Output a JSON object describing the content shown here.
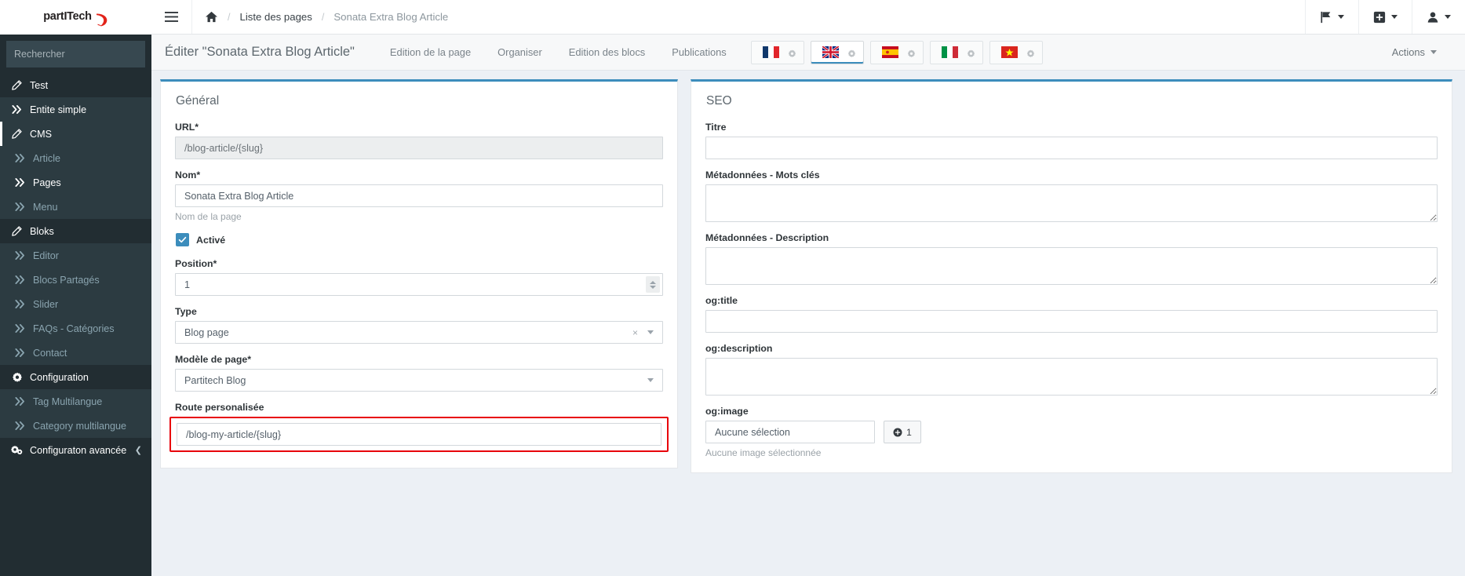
{
  "brand": {
    "logo_text": "partITech",
    "logo_icon": "swoosh-icon"
  },
  "sidebar": {
    "search": {
      "placeholder": "Rechercher",
      "value": "",
      "icon": "search-icon"
    },
    "items": [
      {
        "label": "Test",
        "icon": "pencil-icon",
        "level": 0,
        "state": "normal"
      },
      {
        "label": "Entite simple",
        "icon": "chevron-double-right-icon",
        "level": 0,
        "state": "hover"
      },
      {
        "label": "CMS",
        "icon": "pencil-icon",
        "level": 0,
        "state": "selected"
      },
      {
        "label": "Article",
        "icon": "chevron-double-right-icon",
        "level": 1,
        "state": "sub"
      },
      {
        "label": "Pages",
        "icon": "chevron-double-right-icon",
        "level": 1,
        "state": "sub-active"
      },
      {
        "label": "Menu",
        "icon": "chevron-double-right-icon",
        "level": 1,
        "state": "sub"
      },
      {
        "label": "Bloks",
        "icon": "pencil-icon",
        "level": 0,
        "state": "normal"
      },
      {
        "label": "Editor",
        "icon": "chevron-double-right-icon",
        "level": 1,
        "state": "sub"
      },
      {
        "label": "Blocs Partagés",
        "icon": "chevron-double-right-icon",
        "level": 1,
        "state": "sub"
      },
      {
        "label": "Slider",
        "icon": "chevron-double-right-icon",
        "level": 1,
        "state": "sub"
      },
      {
        "label": "FAQs - Catégories",
        "icon": "chevron-double-right-icon",
        "level": 1,
        "state": "sub"
      },
      {
        "label": "Contact",
        "icon": "chevron-double-right-icon",
        "level": 1,
        "state": "sub"
      },
      {
        "label": "Configuration",
        "icon": "gear-icon",
        "level": 0,
        "state": "normal"
      },
      {
        "label": "Tag Multilangue",
        "icon": "chevron-double-right-icon",
        "level": 1,
        "state": "sub"
      },
      {
        "label": "Category multilangue",
        "icon": "chevron-double-right-icon",
        "level": 1,
        "state": "sub"
      },
      {
        "label": "Configuraton avancée",
        "icon": "gears-icon",
        "level": 0,
        "state": "normal",
        "collapse_icon": "chevron-left-icon"
      }
    ]
  },
  "navbar": {
    "menu_toggle_icon": "hamburger-icon",
    "home_icon": "home-icon",
    "breadcrumb": [
      {
        "label": "Liste des pages",
        "type": "link"
      },
      {
        "label": "Sonata Extra Blog Article",
        "type": "current"
      }
    ],
    "separator": "/",
    "right_items": [
      {
        "icon": "flag-icon",
        "name": "language-dropdown"
      },
      {
        "icon": "plus-square-icon",
        "name": "add-dropdown"
      },
      {
        "icon": "user-icon",
        "name": "user-dropdown"
      }
    ]
  },
  "content_header": {
    "title": "Éditer \"Sonata Extra Blog Article\"",
    "tabs": [
      {
        "label": "Edition de la page",
        "active": false
      },
      {
        "label": "Organiser",
        "active": false
      },
      {
        "label": "Edition des blocs",
        "active": false
      },
      {
        "label": "Publications",
        "active": false
      }
    ],
    "locales": [
      {
        "code": "fr",
        "name": "flag-france-icon",
        "active": false,
        "gear": "gear-icon"
      },
      {
        "code": "en",
        "name": "flag-uk-icon",
        "active": true,
        "gear": "gear-icon"
      },
      {
        "code": "es",
        "name": "flag-spain-icon",
        "active": false,
        "gear": "gear-icon"
      },
      {
        "code": "it",
        "name": "flag-italy-icon",
        "active": false,
        "gear": "gear-icon"
      },
      {
        "code": "vi",
        "name": "flag-vietnam-icon",
        "active": false,
        "gear": "gear-icon"
      }
    ],
    "actions_label": "Actions"
  },
  "general_panel": {
    "title": "Général",
    "url": {
      "label": "URL*",
      "value": "/blog-article/{slug}",
      "disabled": true
    },
    "nom": {
      "label": "Nom*",
      "value": "Sonata Extra Blog Article",
      "help": "Nom de la page"
    },
    "active": {
      "label": "Activé",
      "checked": true
    },
    "position": {
      "label": "Position*",
      "value": "1"
    },
    "type": {
      "label": "Type",
      "value": "Blog page",
      "clear": "×"
    },
    "modele": {
      "label": "Modèle de page*",
      "value": "Partitech Blog"
    },
    "route": {
      "label": "Route personalisée",
      "value": "/blog-my-article/{slug}",
      "highlight_color": "#e8000b"
    }
  },
  "seo_panel": {
    "title": "SEO",
    "fields": [
      {
        "label": "Titre",
        "value": "",
        "type": "input"
      },
      {
        "label": "Métadonnées - Mots clés",
        "value": "",
        "type": "textarea"
      },
      {
        "label": "Métadonnées - Description",
        "value": "",
        "type": "textarea"
      },
      {
        "label": "og:title",
        "value": "",
        "type": "input"
      },
      {
        "label": "og:description",
        "value": "",
        "type": "textarea"
      }
    ],
    "og_image": {
      "label": "og:image",
      "value": "Aucune sélection",
      "button_count": "1",
      "button_icon": "plus-circle-icon",
      "help": "Aucune image sélectionnée"
    }
  },
  "theme": {
    "accent": "#3c8dbc",
    "sidebar_bg": "#222d32",
    "sidebar_sub_bg": "#2c3b41",
    "body_bg": "#ecf0f5",
    "highlight": "#e8000b"
  }
}
